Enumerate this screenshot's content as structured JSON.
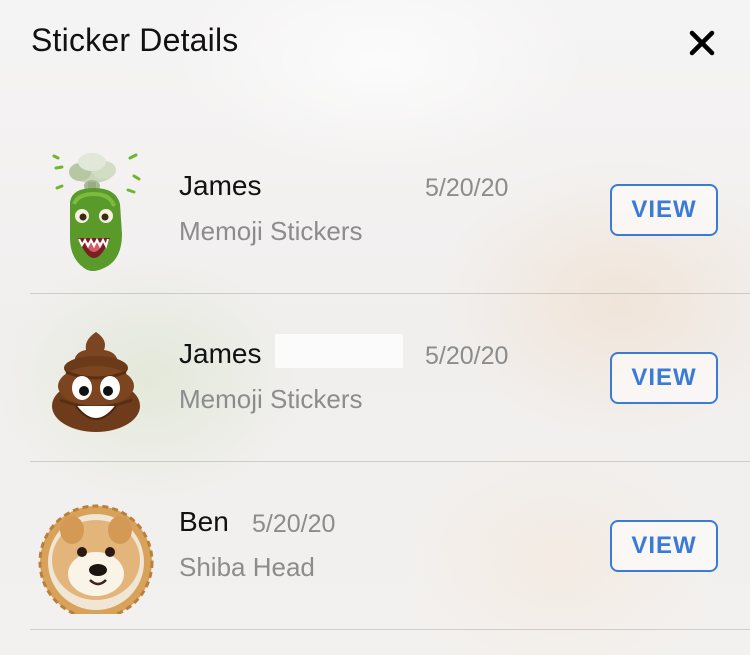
{
  "header": {
    "title": "Sticker Details",
    "close_icon": "close-icon"
  },
  "colors": {
    "accent": "#3a7bd5",
    "secondary_text": "#8c8c8c",
    "primary_text": "#111111"
  },
  "rows": [
    {
      "sticker_icon": "dinosaur-memoji-sticker",
      "name": "James",
      "date": "5/20/20",
      "pack": "Memoji Stickers",
      "action_label": "VIEW"
    },
    {
      "sticker_icon": "poop-memoji-sticker",
      "name": "James",
      "date": "5/20/20",
      "pack": "Memoji Stickers",
      "action_label": "VIEW"
    },
    {
      "sticker_icon": "shiba-head-sticker",
      "name": "Ben",
      "date": "5/20/20",
      "pack": "Shiba Head",
      "action_label": "VIEW"
    }
  ]
}
